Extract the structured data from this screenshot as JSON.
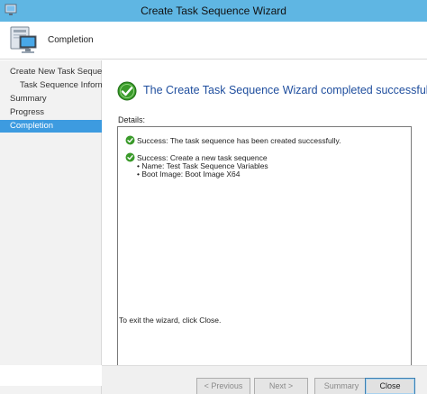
{
  "window": {
    "title": "Create Task Sequence Wizard"
  },
  "header": {
    "title": "Completion"
  },
  "nav": {
    "items": [
      {
        "label": "Create New Task Sequence",
        "level": 0,
        "active": false
      },
      {
        "label": "Task Sequence Informati",
        "level": 1,
        "active": false
      },
      {
        "label": "Summary",
        "level": 0,
        "active": false
      },
      {
        "label": "Progress",
        "level": 0,
        "active": false
      },
      {
        "label": "Completion",
        "level": 0,
        "active": true
      }
    ]
  },
  "content": {
    "status_message": "The Create Task Sequence Wizard completed successfully",
    "details_label": "Details:",
    "details": {
      "line1": "Success: The task sequence has been created successfully.",
      "line2": "Success: Create a new task sequence",
      "line3": "• Name: Test Task Sequence Variables",
      "line4": "• Boot Image: Boot Image X64"
    },
    "exit_text": "To exit the wizard, click Close."
  },
  "footer": {
    "previous_label": "< Previous",
    "next_label": "Next >",
    "summary_label": "Summary",
    "close_label": "Close"
  },
  "colors": {
    "titlebar": "#5fb6e3",
    "nav_active": "#3d9be0",
    "status_text": "#1f4e9e",
    "success_green": "#3a9a2a"
  },
  "icons": {
    "titlebar": "wizard-icon",
    "header": "computer-icon",
    "status": "check-circle-icon"
  }
}
